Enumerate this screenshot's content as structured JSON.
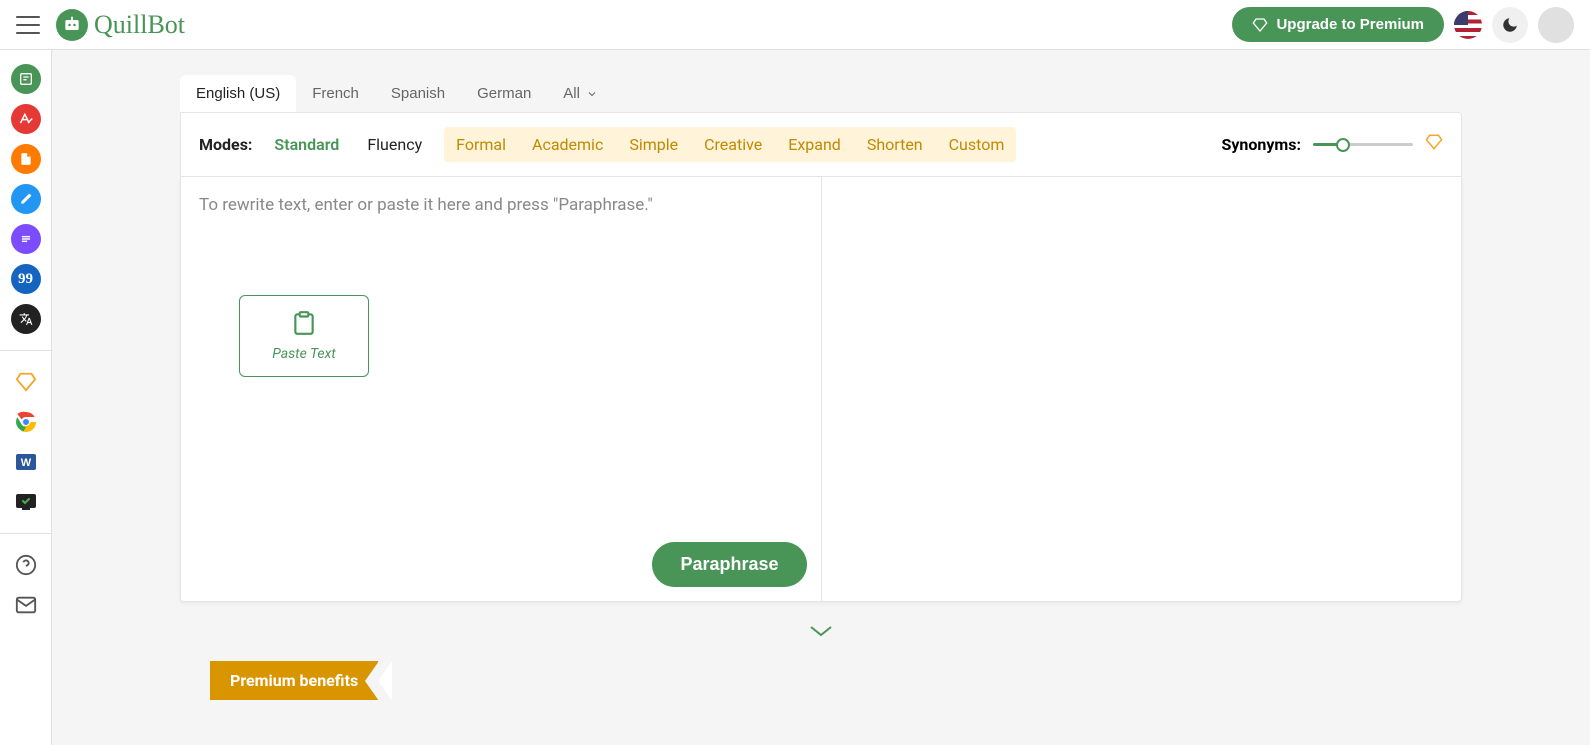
{
  "header": {
    "brand": "QuillBot",
    "upgrade_label": "Upgrade to Premium"
  },
  "languages": {
    "tabs": [
      "English (US)",
      "French",
      "Spanish",
      "German"
    ],
    "all_label": "All"
  },
  "modes": {
    "label": "Modes:",
    "items": [
      "Standard",
      "Fluency",
      "Formal",
      "Academic",
      "Simple",
      "Creative",
      "Expand",
      "Shorten",
      "Custom"
    ],
    "selected_index": 0,
    "premium_start_index": 2
  },
  "synonyms": {
    "label": "Synonyms:"
  },
  "editor": {
    "placeholder": "To rewrite text, enter or paste it here and press \"Paraphrase.\"",
    "paste_label": "Paste Text",
    "paraphrase_label": "Paraphrase"
  },
  "footer": {
    "premium_benefits": "Premium benefits"
  },
  "sidebar": {
    "tools": [
      "paraphraser",
      "grammar",
      "plagiarism",
      "cowriter",
      "summarizer",
      "citation",
      "translator"
    ],
    "extras": [
      "premium",
      "chrome-ext",
      "word-ext",
      "macos-ext"
    ],
    "bottom": [
      "help",
      "feedback"
    ]
  }
}
